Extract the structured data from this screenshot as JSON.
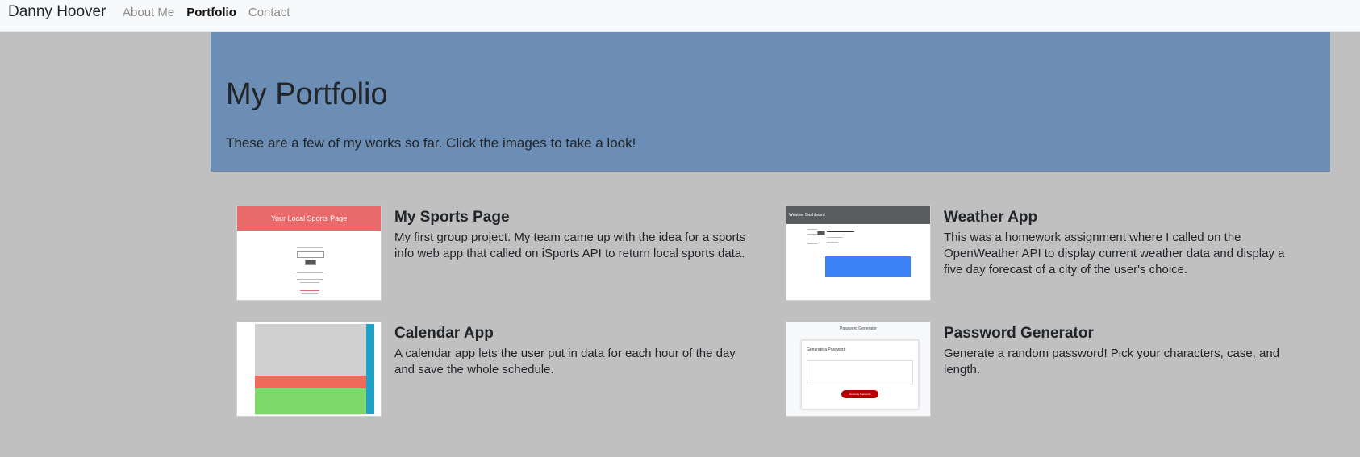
{
  "nav": {
    "brand": "Danny Hoover",
    "links": [
      {
        "label": "About Me",
        "active": false
      },
      {
        "label": "Portfolio",
        "active": true
      },
      {
        "label": "Contact",
        "active": false
      }
    ]
  },
  "hero": {
    "title": "My Portfolio",
    "subtitle": "These are a few of my works so far. Click the images to take a look!"
  },
  "projects": [
    {
      "title": "My Sports Page",
      "description": "My first group project. My team came up with the idea for a sports info web app that called on iSports API to return local sports data.",
      "thumb_text": "Your Local Sports Page"
    },
    {
      "title": "Weather App",
      "description": "This was a homework assignment where I called on the OpenWeather API to display current weather data and display a five day forecast of a city of the user's choice.",
      "thumb_text": "Weather Dashboard"
    },
    {
      "title": "Calendar App",
      "description": "A calendar app lets the user put in data for each hour of the day and save the whole schedule."
    },
    {
      "title": "Password Generator",
      "description": "Generate a random password! Pick your characters, case, and length.",
      "thumb_text": "Password Generator",
      "thumb_card_title": "Generate a Password",
      "thumb_button": "Generate Password"
    }
  ],
  "colors": {
    "page_bg": "#c0c0c0",
    "hero_bg": "#6c8db4",
    "navbar_bg": "#f8f9fa"
  }
}
